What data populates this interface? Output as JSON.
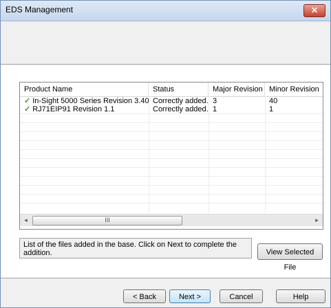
{
  "window": {
    "title": "EDS Management",
    "close_glyph": "✕"
  },
  "list": {
    "columns": [
      "Product Name",
      "Status",
      "Major Revision",
      "Minor Revision"
    ],
    "rows": [
      {
        "name": "In-Sight 5000 Series Revision 3.40",
        "status": "Correctly added.",
        "major": "3",
        "minor": "40"
      },
      {
        "name": "RJ71EIP91 Revision 1.1",
        "status": "Correctly added.",
        "major": "1",
        "minor": "1"
      }
    ],
    "check_glyph": "✓",
    "scroll_left_glyph": "◂",
    "scroll_right_glyph": "▸",
    "scroll_thumb_glyph": "III"
  },
  "info": {
    "text": "List of the files added in the base. Click on Next to complete the addition."
  },
  "buttons": {
    "view_selected": "View Selected File",
    "back": "< Back",
    "next": "Next >",
    "cancel": "Cancel",
    "help": "Help"
  }
}
